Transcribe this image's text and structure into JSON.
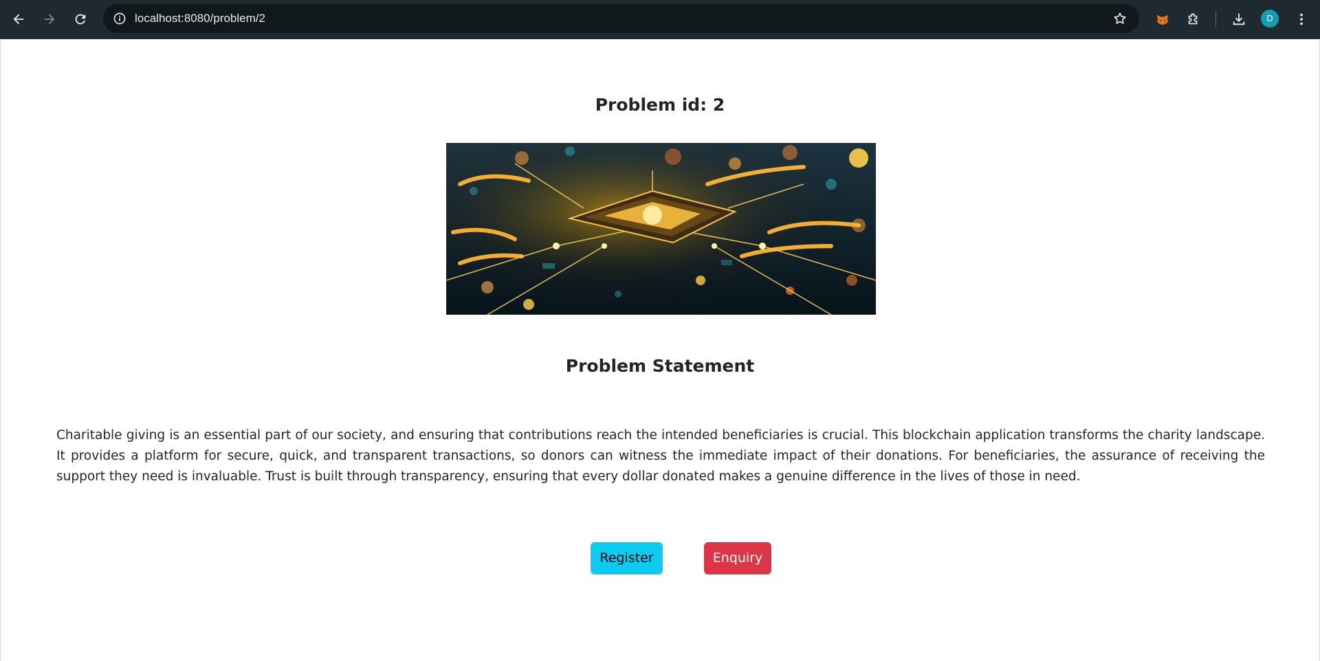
{
  "browser": {
    "url": "localhost:8080/problem/2",
    "profile_initial": "D",
    "colors": {
      "toolbar_bg": "#1f2a30",
      "omnibox_bg": "#10181c",
      "avatar_bg": "#0f9fb4"
    },
    "icons": [
      "back-arrow-icon",
      "forward-arrow-icon",
      "reload-icon",
      "site-info-icon",
      "bookmark-star-icon",
      "fox-extension-icon",
      "extensions-puzzle-icon",
      "download-icon",
      "kebab-menu-icon"
    ]
  },
  "page": {
    "problem_id_label": "Problem id: 2",
    "image": "blockchain circuit board illustration",
    "statement_title": "Problem Statement",
    "statement_text": "Charitable giving is an essential part of our society, and ensuring that contributions reach the intended beneficiaries is crucial. This blockchain application transforms the charity landscape. It provides a platform for secure, quick, and transparent transactions, so donors can witness the immediate impact of their donations. For beneficiaries, the assurance of receiving the support they need is invaluable. Trust is built through transparency, ensuring that every dollar donated makes a genuine difference in the lives of those in need.",
    "buttons": {
      "register_label": "Register",
      "enquiry_label": "Enquiry"
    },
    "colors": {
      "register_bg": "#0dcaf0",
      "enquiry_bg": "#dc3545",
      "text": "#212529"
    }
  }
}
